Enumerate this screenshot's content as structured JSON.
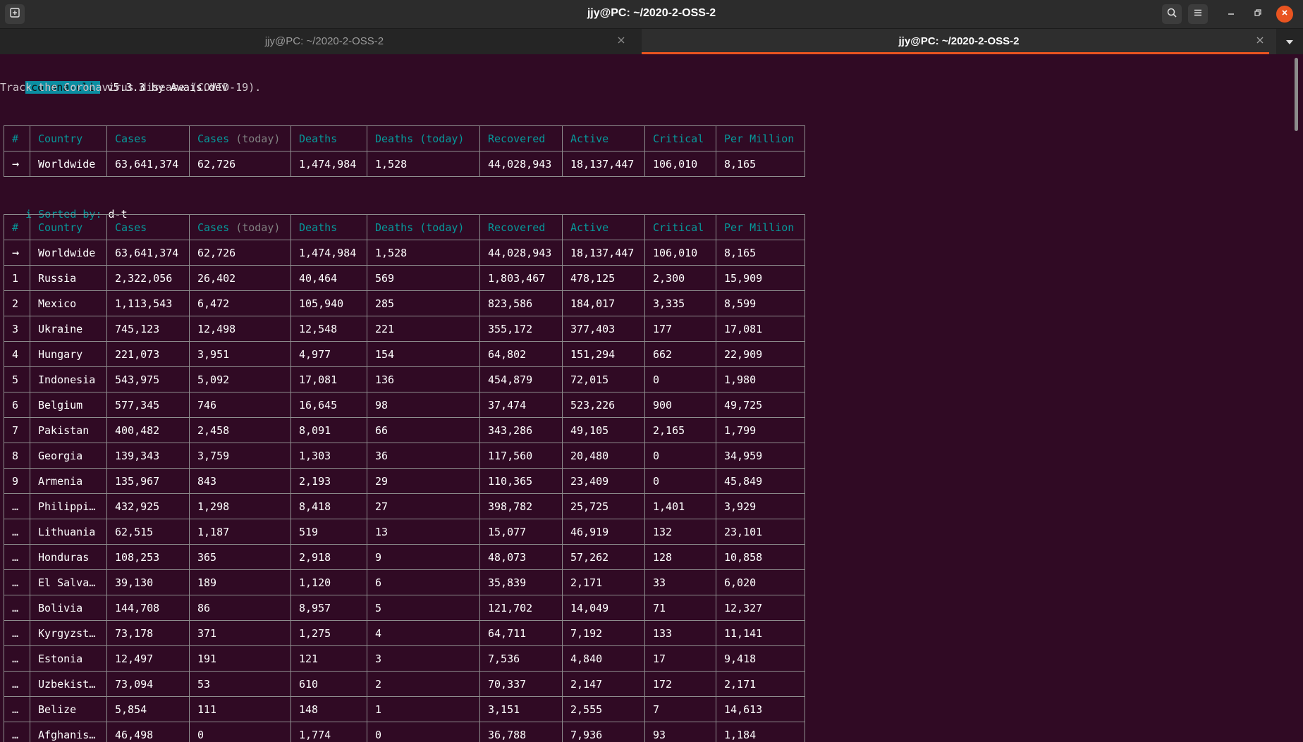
{
  "window": {
    "title": "jjy@PC: ~/2020-2-OSS-2"
  },
  "tabs": [
    {
      "label": "jjy@PC: ~/2020-2-OSS-2",
      "active": false
    },
    {
      "label": "jjy@PC: ~/2020-2-OSS-2",
      "active": true
    }
  ],
  "icons": {
    "new_tab": "new-tab-icon",
    "search": "search-icon",
    "menu": "hamburger-menu-icon",
    "minimize": "minimize-icon",
    "maximize": "restore-icon",
    "close": "close-icon",
    "tab_close": "close-icon",
    "tab_dropdown": "chevron-down-icon"
  },
  "colors": {
    "terminal_bg": "#300a24",
    "accent": "#e95420",
    "header_cyan": "#06989a",
    "deaths_red": "#cc0000",
    "recovered_green": "#4e9a06",
    "active_yellow": "#c4a000"
  },
  "terminal": {
    "badge": "corona-cli",
    "version_text": " v5.3.3 by Awais.dev",
    "subtitle": "Track the Coronavirus disease (COVID-19).",
    "sorted_icon": "i",
    "sorted_label": "Sorted by:",
    "sorted_value": "d-t"
  },
  "table_headers": {
    "num": "#",
    "country": "Country",
    "cases": "Cases",
    "cases_today": "Cases",
    "cases_today_suffix": "(today)",
    "deaths": "Deaths",
    "deaths_today": "Deaths (today)",
    "recovered": "Recovered",
    "active": "Active",
    "critical": "Critical",
    "per_million": "Per Million"
  },
  "worldwide": {
    "num": "→",
    "country": "Worldwide",
    "cases": "63,641,374",
    "cases_today": "62,726",
    "deaths": "1,474,984",
    "deaths_today": "1,528",
    "recovered": "44,028,943",
    "active": "18,137,447",
    "critical": "106,010",
    "per_million": "8,165"
  },
  "rows": [
    {
      "num": "→",
      "country": "Worldwide",
      "cases": "63,641,374",
      "cases_today": "62,726",
      "deaths": "1,474,984",
      "deaths_today": "1,528",
      "recovered": "44,028,943",
      "active": "18,137,447",
      "critical": "106,010",
      "per_million": "8,165"
    },
    {
      "num": "1",
      "country": "Russia",
      "cases": "2,322,056",
      "cases_today": "26,402",
      "deaths": "40,464",
      "deaths_today": "569",
      "recovered": "1,803,467",
      "active": "478,125",
      "critical": "2,300",
      "per_million": "15,909"
    },
    {
      "num": "2",
      "country": "Mexico",
      "cases": "1,113,543",
      "cases_today": "6,472",
      "deaths": "105,940",
      "deaths_today": "285",
      "recovered": "823,586",
      "active": "184,017",
      "critical": "3,335",
      "per_million": "8,599"
    },
    {
      "num": "3",
      "country": "Ukraine",
      "cases": "745,123",
      "cases_today": "12,498",
      "deaths": "12,548",
      "deaths_today": "221",
      "recovered": "355,172",
      "active": "377,403",
      "critical": "177",
      "per_million": "17,081"
    },
    {
      "num": "4",
      "country": "Hungary",
      "cases": "221,073",
      "cases_today": "3,951",
      "deaths": "4,977",
      "deaths_today": "154",
      "recovered": "64,802",
      "active": "151,294",
      "critical": "662",
      "per_million": "22,909"
    },
    {
      "num": "5",
      "country": "Indonesia",
      "cases": "543,975",
      "cases_today": "5,092",
      "deaths": "17,081",
      "deaths_today": "136",
      "recovered": "454,879",
      "active": "72,015",
      "critical": "0",
      "per_million": "1,980"
    },
    {
      "num": "6",
      "country": "Belgium",
      "cases": "577,345",
      "cases_today": "746",
      "deaths": "16,645",
      "deaths_today": "98",
      "recovered": "37,474",
      "active": "523,226",
      "critical": "900",
      "per_million": "49,725"
    },
    {
      "num": "7",
      "country": "Pakistan",
      "cases": "400,482",
      "cases_today": "2,458",
      "deaths": "8,091",
      "deaths_today": "66",
      "recovered": "343,286",
      "active": "49,105",
      "critical": "2,165",
      "per_million": "1,799"
    },
    {
      "num": "8",
      "country": "Georgia",
      "cases": "139,343",
      "cases_today": "3,759",
      "deaths": "1,303",
      "deaths_today": "36",
      "recovered": "117,560",
      "active": "20,480",
      "critical": "0",
      "per_million": "34,959"
    },
    {
      "num": "9",
      "country": "Armenia",
      "cases": "135,967",
      "cases_today": "843",
      "deaths": "2,193",
      "deaths_today": "29",
      "recovered": "110,365",
      "active": "23,409",
      "critical": "0",
      "per_million": "45,849"
    },
    {
      "num": "…",
      "country": "Philippi…",
      "cases": "432,925",
      "cases_today": "1,298",
      "deaths": "8,418",
      "deaths_today": "27",
      "recovered": "398,782",
      "active": "25,725",
      "critical": "1,401",
      "per_million": "3,929"
    },
    {
      "num": "…",
      "country": "Lithuania",
      "cases": "62,515",
      "cases_today": "1,187",
      "deaths": "519",
      "deaths_today": "13",
      "recovered": "15,077",
      "active": "46,919",
      "critical": "132",
      "per_million": "23,101"
    },
    {
      "num": "…",
      "country": "Honduras",
      "cases": "108,253",
      "cases_today": "365",
      "deaths": "2,918",
      "deaths_today": "9",
      "recovered": "48,073",
      "active": "57,262",
      "critical": "128",
      "per_million": "10,858"
    },
    {
      "num": "…",
      "country": "El Salva…",
      "cases": "39,130",
      "cases_today": "189",
      "deaths": "1,120",
      "deaths_today": "6",
      "recovered": "35,839",
      "active": "2,171",
      "critical": "33",
      "per_million": "6,020"
    },
    {
      "num": "…",
      "country": "Bolivia",
      "cases": "144,708",
      "cases_today": "86",
      "deaths": "8,957",
      "deaths_today": "5",
      "recovered": "121,702",
      "active": "14,049",
      "critical": "71",
      "per_million": "12,327"
    },
    {
      "num": "…",
      "country": "Kyrgyzst…",
      "cases": "73,178",
      "cases_today": "371",
      "deaths": "1,275",
      "deaths_today": "4",
      "recovered": "64,711",
      "active": "7,192",
      "critical": "133",
      "per_million": "11,141"
    },
    {
      "num": "…",
      "country": "Estonia",
      "cases": "12,497",
      "cases_today": "191",
      "deaths": "121",
      "deaths_today": "3",
      "recovered": "7,536",
      "active": "4,840",
      "critical": "17",
      "per_million": "9,418"
    },
    {
      "num": "…",
      "country": "Uzbekist…",
      "cases": "73,094",
      "cases_today": "53",
      "deaths": "610",
      "deaths_today": "2",
      "recovered": "70,337",
      "active": "2,147",
      "critical": "172",
      "per_million": "2,171"
    },
    {
      "num": "…",
      "country": "Belize",
      "cases": "5,854",
      "cases_today": "111",
      "deaths": "148",
      "deaths_today": "1",
      "recovered": "3,151",
      "active": "2,555",
      "critical": "7",
      "per_million": "14,613"
    },
    {
      "num": "…",
      "country": "Afghanis…",
      "cases": "46,498",
      "cases_today": "0",
      "deaths": "1,774",
      "deaths_today": "0",
      "recovered": "36,788",
      "active": "7,936",
      "critical": "93",
      "per_million": "1,184"
    }
  ]
}
